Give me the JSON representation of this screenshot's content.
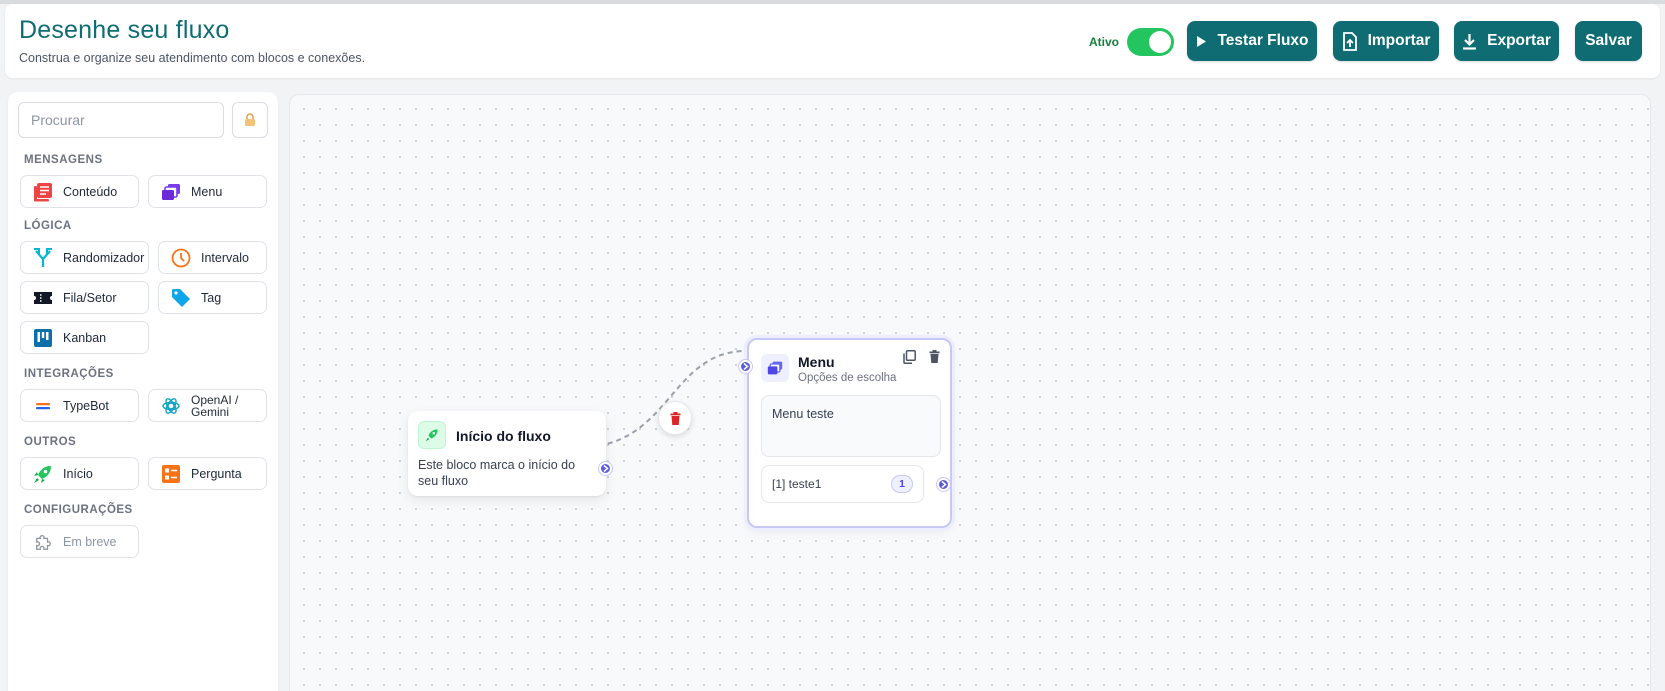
{
  "header": {
    "title": "Desenhe seu fluxo",
    "subtitle": "Construa e organize seu atendimento com blocos e conexões.",
    "active_label": "Ativo",
    "active_on": true,
    "buttons": {
      "test": "Testar Fluxo",
      "import": "Importar",
      "export": "Exportar",
      "save": "Salvar"
    }
  },
  "sidebar": {
    "search_placeholder": "Procurar",
    "sections": {
      "messages": {
        "title": "MENSAGENS",
        "items": [
          "Conteúdo",
          "Menu"
        ]
      },
      "logic": {
        "title": "LÓGICA",
        "items": [
          "Randomizador",
          "Intervalo",
          "Fila/Setor",
          "Tag",
          "Kanban"
        ]
      },
      "integrations": {
        "title": "INTEGRAÇÕES",
        "items": [
          "TypeBot",
          "OpenAI /",
          "Gemini"
        ]
      },
      "others": {
        "title": "OUTROS",
        "items": [
          "Início",
          "Pergunta"
        ]
      },
      "settings": {
        "title": "CONFIGURAÇÕES",
        "items": [
          "Em breve"
        ]
      }
    }
  },
  "canvas": {
    "start_node": {
      "title": "Início do fluxo",
      "description": "Este bloco marca o início do seu fluxo"
    },
    "menu_node": {
      "title": "Menu",
      "subtitle": "Opções de escolha",
      "message": "Menu teste",
      "option_label": "[1] teste1",
      "option_badge": "1"
    }
  },
  "colors": {
    "brand": "#0f6c72",
    "toggle_on": "#22c55e",
    "handle": "#5b5fd6",
    "delete": "#dc2626"
  }
}
